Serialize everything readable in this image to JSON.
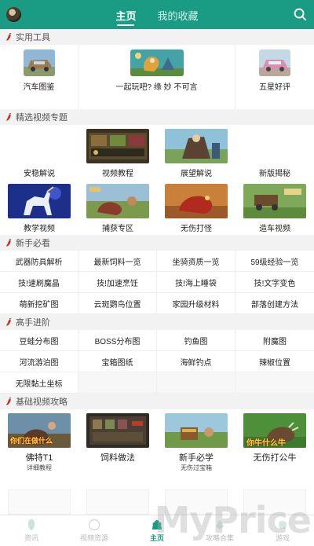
{
  "header": {
    "tabs": [
      {
        "label": "主页",
        "active": true
      },
      {
        "label": "我的收藏",
        "active": false
      }
    ],
    "search_icon": "search-icon",
    "accent": "#199b84"
  },
  "tools": {
    "title": "实用工具",
    "items": [
      {
        "label": "汽车图鉴",
        "icon": "car-image"
      },
      {
        "label": "一起玩吧? 缘 妙 不可言",
        "icon": "game-banner-image"
      },
      {
        "label": "五星好评",
        "icon": "pink-car-image"
      }
    ]
  },
  "featured": {
    "title": "精选视频专题",
    "items": [
      {
        "label": "安稳解说"
      },
      {
        "label": "视频教程"
      },
      {
        "label": "展望解说"
      },
      {
        "label": "新版揭秘"
      },
      {
        "label": "教学视频"
      },
      {
        "label": "捕获专区"
      },
      {
        "label": "无伤打怪"
      },
      {
        "label": "造车视频"
      }
    ]
  },
  "novice": {
    "title": "新手必看",
    "items": [
      "武器防具解析",
      "最新饲料一览",
      "坐骑资质一览",
      "59级经验一览",
      "技!速刷魔晶",
      "技!加速烹饪",
      "技!海上睡袋",
      "技!文字变色",
      "萌新挖矿图",
      "云斑鹦鸟位置",
      "家园升级材料",
      "部落创建方法"
    ]
  },
  "advanced": {
    "title": "高手进阶",
    "items": [
      "豆蛙分布图",
      "BOSS分布图",
      "钓鱼图",
      "附魔图",
      "河流游泊图",
      "宝箱图纸",
      "海鲜钓点",
      "辣椒位置",
      "无限黏土坐标"
    ]
  },
  "basic": {
    "title": "基础视频攻略",
    "items": [
      {
        "label": "佛特T1",
        "sub": "详细教程",
        "overlay": "你们在做什么"
      },
      {
        "label": "饲料做法",
        "sub": "",
        "overlay": ""
      },
      {
        "label": "新手必学",
        "sub": "无伤过宝箱",
        "overlay": ""
      },
      {
        "label": "无伤打公牛",
        "sub": "",
        "overlay": "你牛什么牛"
      }
    ]
  },
  "bottom_nav": [
    {
      "label": "资讯",
      "icon": "news-icon",
      "active": false
    },
    {
      "label": "视频资源",
      "icon": "video-icon",
      "active": false
    },
    {
      "label": "主页",
      "icon": "home-icon",
      "active": true
    },
    {
      "label": "攻略合集",
      "icon": "guide-icon",
      "active": false
    },
    {
      "label": "游戏",
      "icon": "game-icon",
      "active": false
    }
  ],
  "watermark": "MyPrice"
}
